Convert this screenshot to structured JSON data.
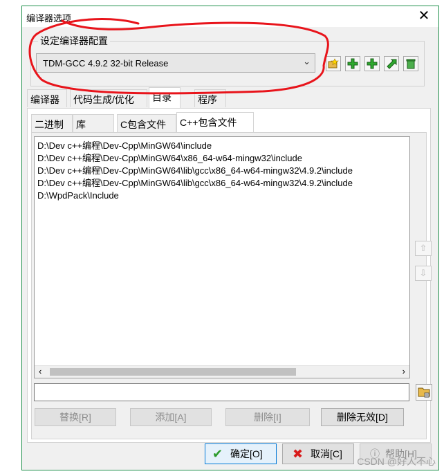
{
  "window": {
    "title": "编译器选项",
    "close_symbol": "✕"
  },
  "compiler_set": {
    "legend": "设定编译器配置",
    "selected": "TDM-GCC 4.9.2 32-bit Release",
    "toolbar_icons": [
      "add-folder-icon",
      "add-plus-icon",
      "add-plus-icon-2",
      "rename-icon",
      "delete-trash-icon"
    ]
  },
  "main_tabs": [
    "编译器",
    "代码生成/优化",
    "目录",
    "程序"
  ],
  "sub_tabs": [
    "二进制",
    "库",
    "C包含文件",
    "C++包含文件"
  ],
  "include_paths": [
    "D:\\Dev c++编程\\Dev-Cpp\\MinGW64\\include",
    "D:\\Dev c++编程\\Dev-Cpp\\MinGW64\\x86_64-w64-mingw32\\include",
    "D:\\Dev c++编程\\Dev-Cpp\\MinGW64\\lib\\gcc\\x86_64-w64-mingw32\\4.9.2\\include",
    "D:\\Dev c++编程\\Dev-Cpp\\MinGW64\\lib\\gcc\\x86_64-w64-mingw32\\4.9.2\\include",
    "D:\\WpdPack\\Include"
  ],
  "path_input": {
    "value": ""
  },
  "list_buttons": {
    "replace": "替换[R]",
    "add": "添加[A]",
    "delete": "删除[I]",
    "delete_invalid": "删除无效[D]"
  },
  "dialog_buttons": {
    "ok": "确定[O]",
    "cancel": "取消[C]",
    "help": "帮助[H]"
  },
  "watermark": "CSDN @好人不心",
  "colors": {
    "accent": "#0078d7",
    "annotation": "#e8141b",
    "title_border": "#1f8f4a"
  }
}
